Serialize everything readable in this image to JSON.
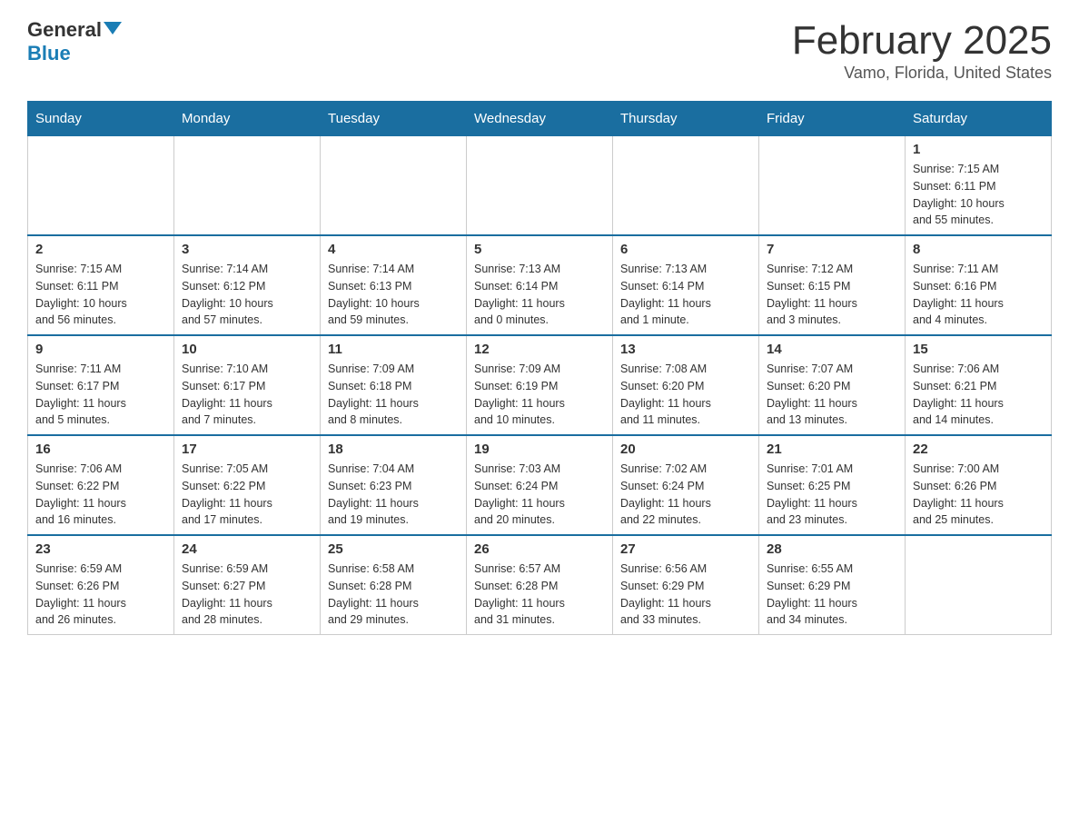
{
  "header": {
    "logo_general": "General",
    "logo_blue": "Blue",
    "month_title": "February 2025",
    "location": "Vamo, Florida, United States"
  },
  "weekdays": [
    "Sunday",
    "Monday",
    "Tuesday",
    "Wednesday",
    "Thursday",
    "Friday",
    "Saturday"
  ],
  "weeks": [
    {
      "days": [
        {
          "num": "",
          "info": ""
        },
        {
          "num": "",
          "info": ""
        },
        {
          "num": "",
          "info": ""
        },
        {
          "num": "",
          "info": ""
        },
        {
          "num": "",
          "info": ""
        },
        {
          "num": "",
          "info": ""
        },
        {
          "num": "1",
          "info": "Sunrise: 7:15 AM\nSunset: 6:11 PM\nDaylight: 10 hours\nand 55 minutes."
        }
      ]
    },
    {
      "days": [
        {
          "num": "2",
          "info": "Sunrise: 7:15 AM\nSunset: 6:11 PM\nDaylight: 10 hours\nand 56 minutes."
        },
        {
          "num": "3",
          "info": "Sunrise: 7:14 AM\nSunset: 6:12 PM\nDaylight: 10 hours\nand 57 minutes."
        },
        {
          "num": "4",
          "info": "Sunrise: 7:14 AM\nSunset: 6:13 PM\nDaylight: 10 hours\nand 59 minutes."
        },
        {
          "num": "5",
          "info": "Sunrise: 7:13 AM\nSunset: 6:14 PM\nDaylight: 11 hours\nand 0 minutes."
        },
        {
          "num": "6",
          "info": "Sunrise: 7:13 AM\nSunset: 6:14 PM\nDaylight: 11 hours\nand 1 minute."
        },
        {
          "num": "7",
          "info": "Sunrise: 7:12 AM\nSunset: 6:15 PM\nDaylight: 11 hours\nand 3 minutes."
        },
        {
          "num": "8",
          "info": "Sunrise: 7:11 AM\nSunset: 6:16 PM\nDaylight: 11 hours\nand 4 minutes."
        }
      ]
    },
    {
      "days": [
        {
          "num": "9",
          "info": "Sunrise: 7:11 AM\nSunset: 6:17 PM\nDaylight: 11 hours\nand 5 minutes."
        },
        {
          "num": "10",
          "info": "Sunrise: 7:10 AM\nSunset: 6:17 PM\nDaylight: 11 hours\nand 7 minutes."
        },
        {
          "num": "11",
          "info": "Sunrise: 7:09 AM\nSunset: 6:18 PM\nDaylight: 11 hours\nand 8 minutes."
        },
        {
          "num": "12",
          "info": "Sunrise: 7:09 AM\nSunset: 6:19 PM\nDaylight: 11 hours\nand 10 minutes."
        },
        {
          "num": "13",
          "info": "Sunrise: 7:08 AM\nSunset: 6:20 PM\nDaylight: 11 hours\nand 11 minutes."
        },
        {
          "num": "14",
          "info": "Sunrise: 7:07 AM\nSunset: 6:20 PM\nDaylight: 11 hours\nand 13 minutes."
        },
        {
          "num": "15",
          "info": "Sunrise: 7:06 AM\nSunset: 6:21 PM\nDaylight: 11 hours\nand 14 minutes."
        }
      ]
    },
    {
      "days": [
        {
          "num": "16",
          "info": "Sunrise: 7:06 AM\nSunset: 6:22 PM\nDaylight: 11 hours\nand 16 minutes."
        },
        {
          "num": "17",
          "info": "Sunrise: 7:05 AM\nSunset: 6:22 PM\nDaylight: 11 hours\nand 17 minutes."
        },
        {
          "num": "18",
          "info": "Sunrise: 7:04 AM\nSunset: 6:23 PM\nDaylight: 11 hours\nand 19 minutes."
        },
        {
          "num": "19",
          "info": "Sunrise: 7:03 AM\nSunset: 6:24 PM\nDaylight: 11 hours\nand 20 minutes."
        },
        {
          "num": "20",
          "info": "Sunrise: 7:02 AM\nSunset: 6:24 PM\nDaylight: 11 hours\nand 22 minutes."
        },
        {
          "num": "21",
          "info": "Sunrise: 7:01 AM\nSunset: 6:25 PM\nDaylight: 11 hours\nand 23 minutes."
        },
        {
          "num": "22",
          "info": "Sunrise: 7:00 AM\nSunset: 6:26 PM\nDaylight: 11 hours\nand 25 minutes."
        }
      ]
    },
    {
      "days": [
        {
          "num": "23",
          "info": "Sunrise: 6:59 AM\nSunset: 6:26 PM\nDaylight: 11 hours\nand 26 minutes."
        },
        {
          "num": "24",
          "info": "Sunrise: 6:59 AM\nSunset: 6:27 PM\nDaylight: 11 hours\nand 28 minutes."
        },
        {
          "num": "25",
          "info": "Sunrise: 6:58 AM\nSunset: 6:28 PM\nDaylight: 11 hours\nand 29 minutes."
        },
        {
          "num": "26",
          "info": "Sunrise: 6:57 AM\nSunset: 6:28 PM\nDaylight: 11 hours\nand 31 minutes."
        },
        {
          "num": "27",
          "info": "Sunrise: 6:56 AM\nSunset: 6:29 PM\nDaylight: 11 hours\nand 33 minutes."
        },
        {
          "num": "28",
          "info": "Sunrise: 6:55 AM\nSunset: 6:29 PM\nDaylight: 11 hours\nand 34 minutes."
        },
        {
          "num": "",
          "info": ""
        }
      ]
    }
  ]
}
